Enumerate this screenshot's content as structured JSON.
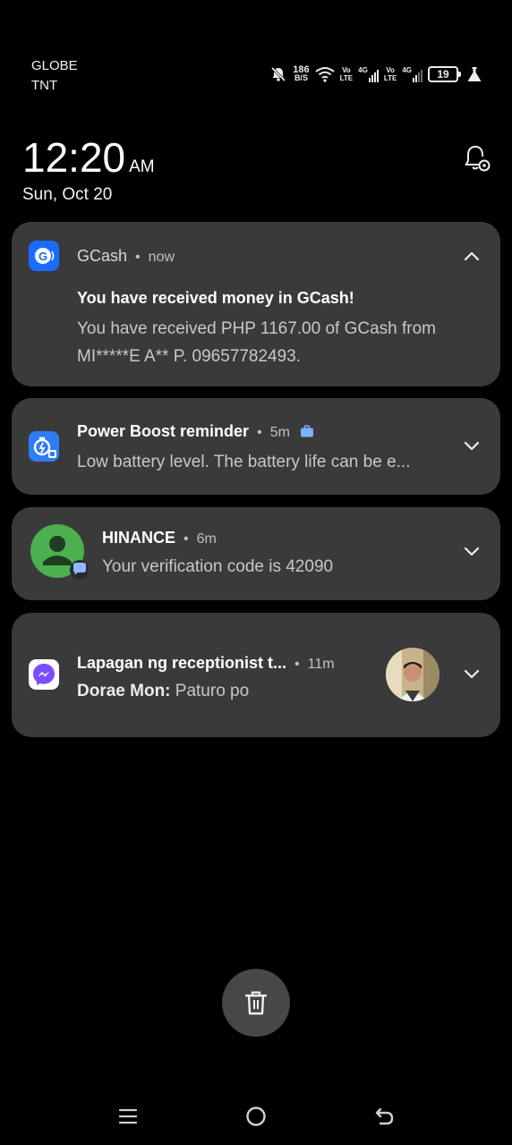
{
  "status_bar": {
    "carrier_line1": "GLOBE",
    "carrier_line2": "TNT",
    "speed_value": "186",
    "speed_unit": "B/S",
    "volte_top": "Vo",
    "volte_bottom": "LTE",
    "net_label": "4G",
    "battery_level": "19"
  },
  "lockscreen": {
    "time": "12:20",
    "ampm": "AM",
    "date": "Sun, Oct 20"
  },
  "notifications": [
    {
      "app": "GCash",
      "time": "now",
      "title": "You have received money in GCash!",
      "body_line1": "You have received PHP 1167.00 of GCash from",
      "body_line2": "MI*****E A** P. 09657782493."
    },
    {
      "title": "Power Boost reminder",
      "time": "5m",
      "body": "Low battery level. The battery life can be e..."
    },
    {
      "title": "HINANCE",
      "time": "6m",
      "body": "Your verification code is 42090"
    },
    {
      "title": "Lapagan ng receptionist t...",
      "time": "11m",
      "sender": "Dorae Mon:",
      "message": "Paturo po"
    }
  ],
  "separator": "•",
  "colors": {
    "card_bg": "#3a3a3a",
    "gcash_blue": "#1a6cff",
    "power_boost_blue": "#2f7df6",
    "hinance_green": "#4caf50",
    "messenger_purple": "#7b4dff",
    "fab_bg": "#474747"
  },
  "icons": {
    "fab": "trash-icon",
    "nav_recents": "recents-icon",
    "nav_home": "home-icon",
    "nav_back": "back-icon"
  }
}
